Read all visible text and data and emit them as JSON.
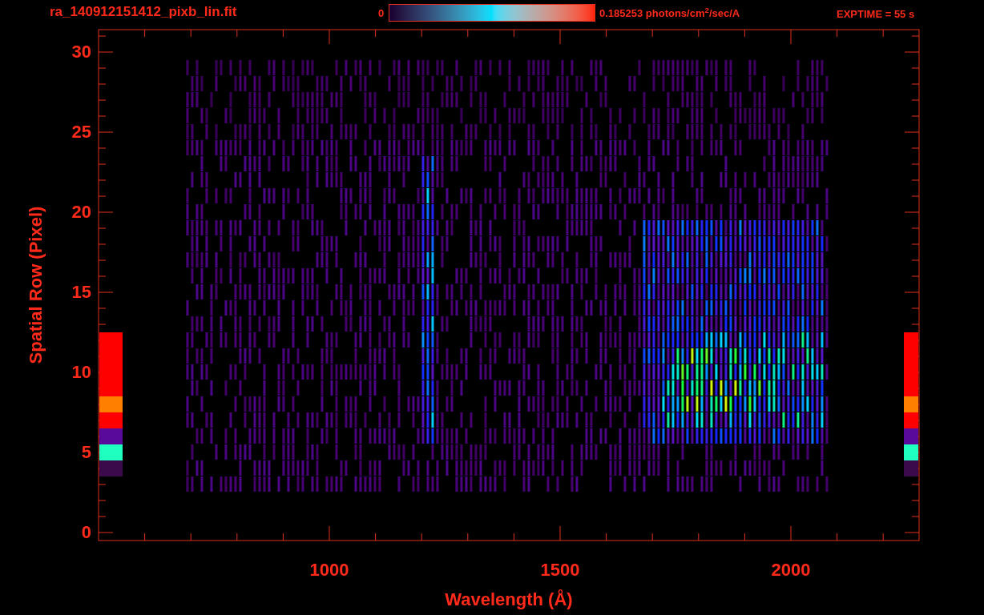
{
  "title": "ra_140912151412_pixb_lin.fit",
  "colorbar": {
    "min_label": "0",
    "max_label": "0.185253 photons/cm$^{2}$/sec/A"
  },
  "exposure": "EXPTIME = 55 s",
  "y_axis": {
    "label": "Spatial Row (Pixel)",
    "tick_labels": [
      "30",
      "25",
      "20",
      "15",
      "10",
      "5",
      "0"
    ]
  },
  "x_axis": {
    "label": "Wavelength (Å)",
    "tick_labels": [
      "1000",
      "1500",
      "2000"
    ]
  },
  "row_markers": [
    {
      "color": "#ff0000"
    },
    {
      "color": "#ff0000"
    },
    {
      "color": "#ff0000"
    },
    {
      "color": "#ff0000"
    },
    {
      "color": "#ff7f00"
    },
    {
      "color": "#ff0000"
    },
    {
      "color": "#5a0a9a"
    },
    {
      "color": "#1effc0"
    },
    {
      "color": "#3a0a4a"
    }
  ]
}
